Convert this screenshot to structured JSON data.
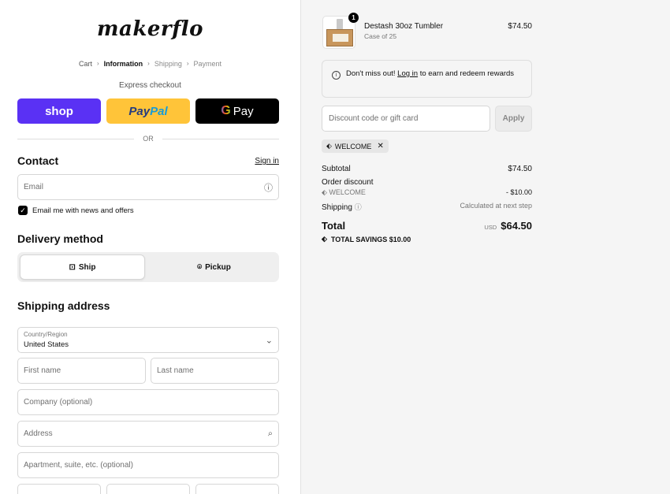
{
  "logo": {
    "text": "makerflo"
  },
  "breadcrumb": {
    "cart": "Cart",
    "information": "Information",
    "shipping": "Shipping",
    "payment": "Payment"
  },
  "express": {
    "label": "Express checkout",
    "shop": "shop",
    "paypal_a": "Pay",
    "paypal_b": "Pal",
    "gpay_g": "G",
    "gpay_text": "Pay",
    "or": "OR"
  },
  "contact": {
    "title": "Contact",
    "sign_in": "Sign in",
    "email_placeholder": "Email",
    "newsletter": "Email me with news and offers",
    "newsletter_checked": true
  },
  "delivery": {
    "title": "Delivery method",
    "ship": "Ship",
    "pickup": "Pickup",
    "selected": "Ship"
  },
  "shipping_address": {
    "title": "Shipping address",
    "country_label": "Country/Region",
    "country_value": "United States",
    "first_name": "First name",
    "last_name": "Last name",
    "company": "Company (optional)",
    "address": "Address",
    "apartment": "Apartment, suite, etc. (optional)"
  },
  "order": {
    "item": {
      "name": "Destash 30oz Tumbler",
      "variant": "Case of 25",
      "price": "$74.50",
      "quantity": "1"
    },
    "notice": {
      "before": "Don't miss out! ",
      "link": "Log in",
      "after": " to earn and redeem rewards"
    },
    "discount_placeholder": "Discount code or gift card",
    "apply": "Apply",
    "applied_code": "WELCOME",
    "subtotal_label": "Subtotal",
    "subtotal_value": "$74.50",
    "order_discount_label": "Order discount",
    "order_discount_code": "WELCOME",
    "order_discount_value": "- $10.00",
    "shipping_label": "Shipping",
    "shipping_value": "Calculated at next step",
    "total_label": "Total",
    "currency": "USD",
    "total_value": "$64.50",
    "savings_label": "TOTAL SAVINGS",
    "savings_value": "$10.00"
  }
}
